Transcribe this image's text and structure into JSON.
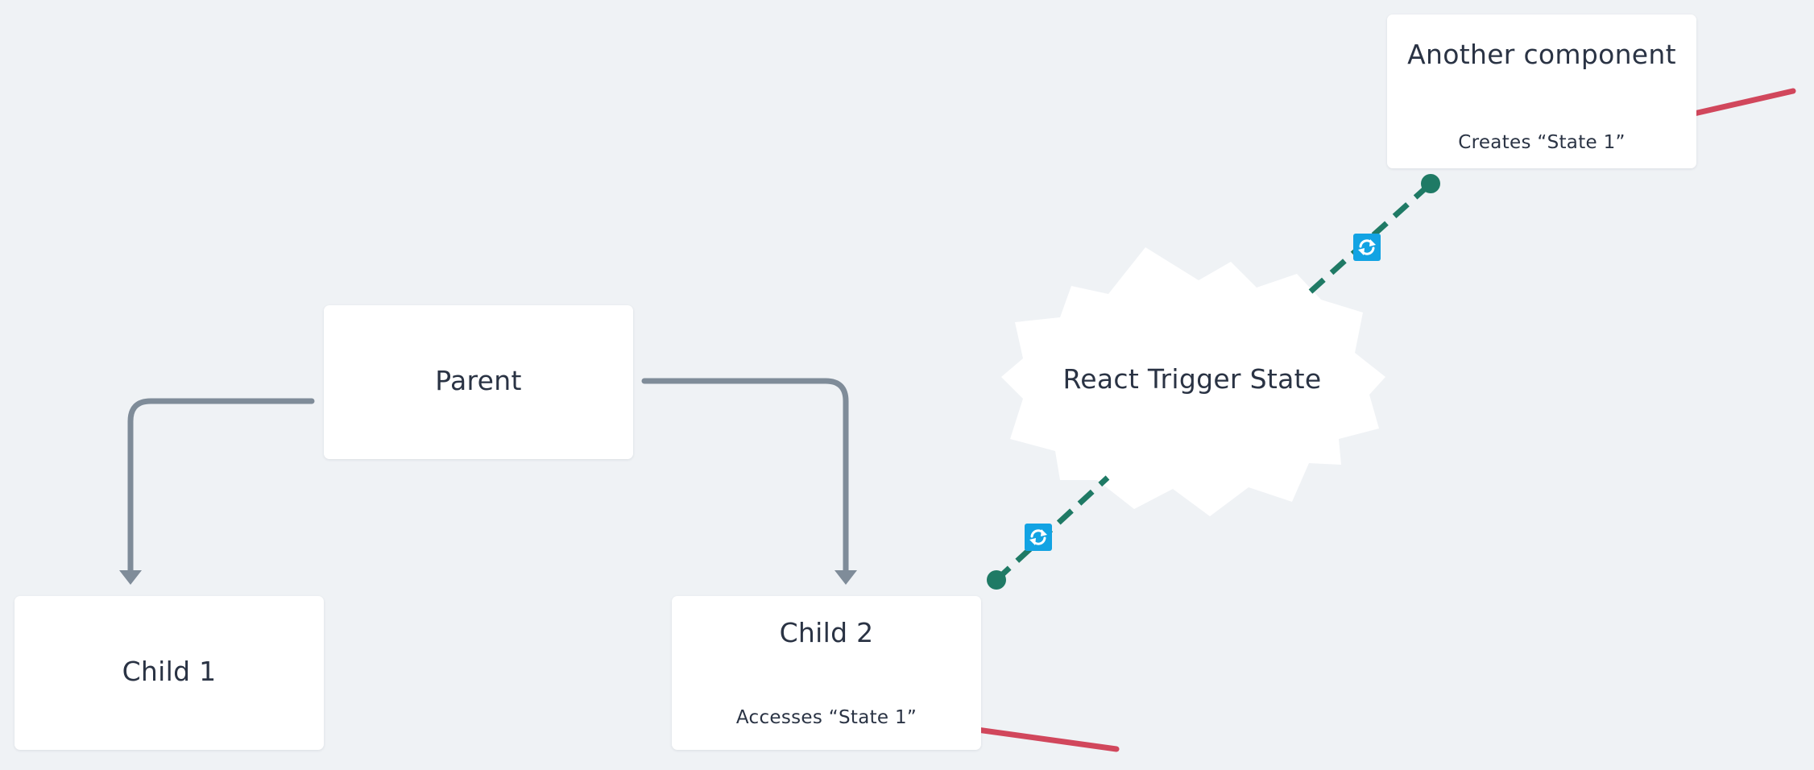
{
  "nodes": {
    "parent": {
      "title": "Parent"
    },
    "child1": {
      "title": "Child 1"
    },
    "child2": {
      "title": "Child 2",
      "note": "Accesses “State 1”"
    },
    "another": {
      "title": "Another component",
      "note": "Creates “State 1”"
    },
    "trigger": {
      "title": "React Trigger State"
    }
  },
  "colors": {
    "background": "#eff2f5",
    "node": "#ffffff",
    "hierarchy_connector": "#7f8c99",
    "state_link": "#1f7a65",
    "state_link_badge": "#12a3e3",
    "annotation_arrow": "#d1475c",
    "text": "#2a3344"
  },
  "icons": {
    "state_link_badge": "sync-icon"
  }
}
